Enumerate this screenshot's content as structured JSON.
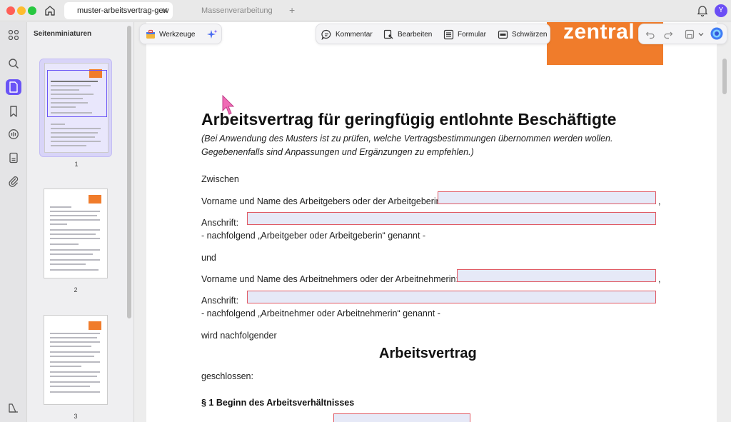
{
  "window": {
    "tabs": [
      {
        "label": "muster-arbeitsvertrag-gew",
        "active": true
      },
      {
        "label": "Massenverarbeitung",
        "active": false
      }
    ],
    "tab_close": "✕",
    "tab_add": "+",
    "avatar_initial": "Y"
  },
  "sidebar": {
    "title": "Seitenminiaturen",
    "pages": [
      {
        "number": "1",
        "selected": true
      },
      {
        "number": "2",
        "selected": false
      },
      {
        "number": "3",
        "selected": false
      }
    ]
  },
  "toolbar": {
    "tools_label": "Werkzeuge",
    "comment_label": "Kommentar",
    "edit_label": "Bearbeiten",
    "form_label": "Formular",
    "redact_label": "Schwärzen"
  },
  "document": {
    "logo_text": "zentral",
    "title": "Arbeitsvertrag für geringfügig entlohnte Beschäftigte",
    "intro_line1": "(Bei Anwendung des Musters ist zu prüfen, welche Vertragsbestimmungen übernommen werden wollen.",
    "intro_line2": "Gegebenenfalls sind Anpassungen und Ergänzungen zu empfehlen.)",
    "between": "Zwischen",
    "employer_name_label": "Vorname und Name des Arbeitgebers oder der Arbeitgeberin:",
    "address_label": "Anschrift:",
    "employer_note": "- nachfolgend „Arbeitgeber oder Arbeitgeberin“ genannt -",
    "and": "und",
    "employee_name_label": "Vorname und Name des Arbeitnehmers oder der Arbeitnehmerin:",
    "employee_note": "- nachfolgend „Arbeitnehmer oder Arbeitnehmerin“ genannt -",
    "following": "wird nachfolgender",
    "contract_heading": "Arbeitsvertrag",
    "concluded": "geschlossen:",
    "section1": "§ 1 Beginn des Arbeitsverhältnisses",
    "comma": ","
  },
  "colors": {
    "accent": "#6a54f6",
    "brand_orange": "#f07c2b",
    "field_border": "#e05a64",
    "field_fill": "#e6e9f7"
  }
}
